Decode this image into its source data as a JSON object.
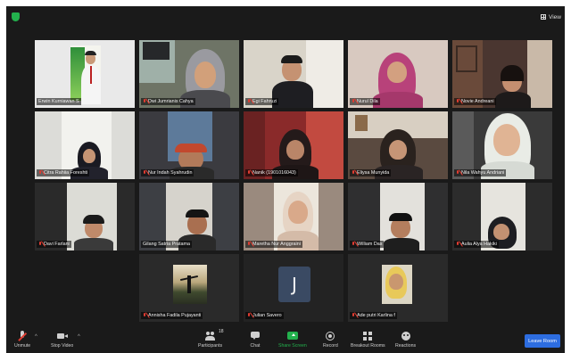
{
  "window": {
    "view_label": "View"
  },
  "participants": [
    {
      "name": "Erwin Kurniawan S",
      "muted": false,
      "active": true
    },
    {
      "name": "Dwi Jumrianis Cahya",
      "muted": true
    },
    {
      "name": "Egi Fahruzi",
      "muted": true
    },
    {
      "name": "Nurul Dila",
      "muted": true
    },
    {
      "name": "Novie Andreani",
      "muted": true
    },
    {
      "name": "Citra Rahiia Foreshti",
      "muted": true
    },
    {
      "name": "Nur Indah Syahrudin",
      "muted": true
    },
    {
      "name": "Nanik (1901016043)",
      "muted": true
    },
    {
      "name": "Eliysa Munyida",
      "muted": true
    },
    {
      "name": "Nila Wahyu Andriani",
      "muted": true
    },
    {
      "name": "Davi Farlani",
      "muted": true
    },
    {
      "name": "Gilang Satria Pratama",
      "muted": false
    },
    {
      "name": "Maretha Nur Anggraini",
      "muted": true
    },
    {
      "name": "William Das",
      "muted": true
    },
    {
      "name": "Aulia Alya Hakiki",
      "muted": true
    },
    {
      "name": "Annisha Fadila Pujayanti",
      "muted": true
    },
    {
      "name": "Julian Savero",
      "muted": true,
      "initial": "J"
    },
    {
      "name": "Ade putri Karlina f",
      "muted": true
    }
  ],
  "toolbar": {
    "unmute": "Unmute",
    "stop_video": "Stop Video",
    "participants": "Participants",
    "participants_count": "18",
    "chat": "Chat",
    "share_screen": "Share Screen",
    "record": "Record",
    "breakout_rooms": "Breakout Rooms",
    "reactions": "Reactions",
    "leave": "Leave Room"
  },
  "colors": {
    "active_speaker": "#e5e44a",
    "share": "#23b14d",
    "leave": "#2d6de0",
    "muted": "#e03c31"
  }
}
